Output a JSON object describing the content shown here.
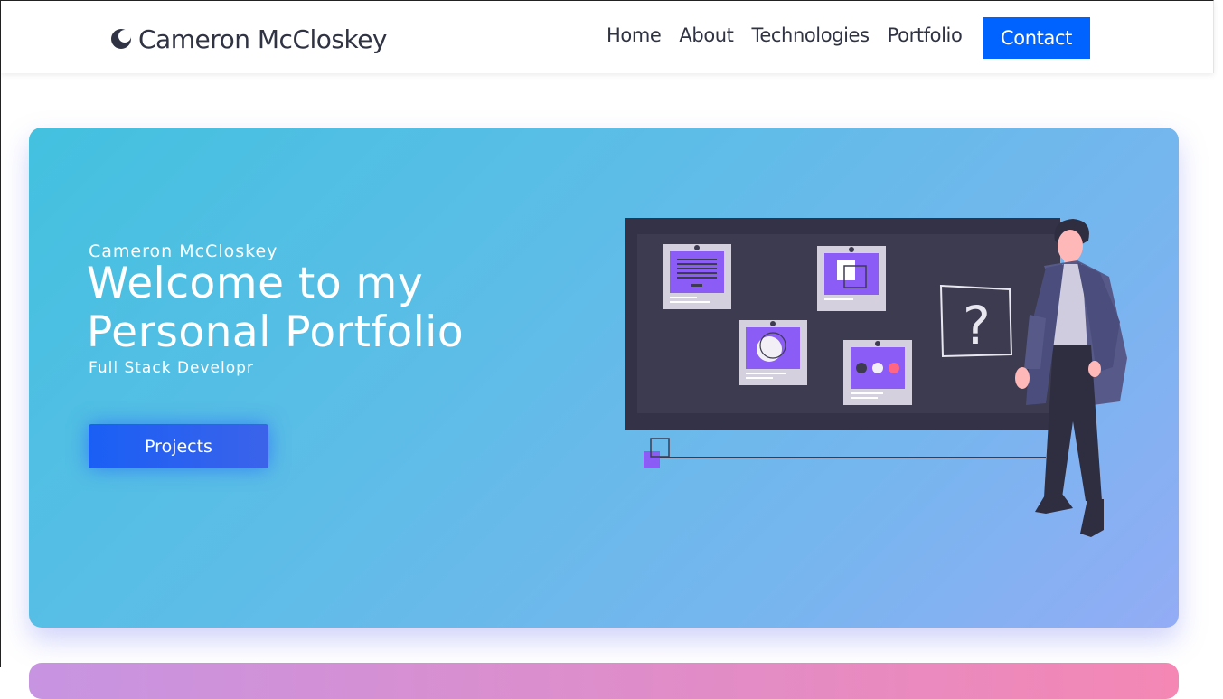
{
  "navbar": {
    "brand": "Cameron McCloskey",
    "brand_icon": "crescent-logo-icon",
    "links": [
      "Home",
      "About",
      "Technologies",
      "Portfolio"
    ],
    "contact_label": "Contact",
    "accent": "#0062ff"
  },
  "hero": {
    "subtitle": "Cameron McCloskey",
    "headline_line1": "Welcome to my",
    "headline_line2": "Personal Portfolio",
    "role": "Full Stack Developr",
    "cta_label": "Projects",
    "illustration": "person-at-board-illustration",
    "gradient": [
      "#43c1df",
      "#93acf5"
    ]
  }
}
